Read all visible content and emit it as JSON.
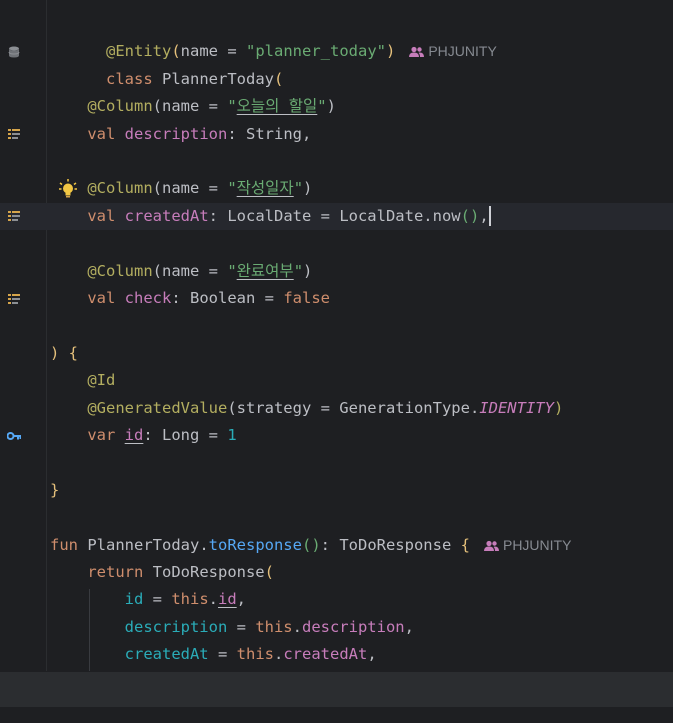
{
  "author_hint": "PHJUNITY",
  "lines": {
    "l1": {
      "ann": "@Entity",
      "p1": "(name = ",
      "str": "\"planner_today\"",
      "p2": ")"
    },
    "l2": {
      "kw": "class",
      "name": " PlannerToday",
      "paren": "("
    },
    "l4": {
      "ann": "@Column",
      "p1": "(name = ",
      "q1": "\"",
      "ko": "오늘의 할일",
      "q2": "\"",
      "p2": ")"
    },
    "l5": {
      "kw": "val",
      "prop": "description",
      "rest": ": String,"
    },
    "l7": {
      "ann": "@Column",
      "p1": "(name = ",
      "q1": "\"",
      "ko": "작성일자",
      "q2": "\"",
      "p2": ")"
    },
    "l8": {
      "kw": "val",
      "prop": "createdAt",
      "rest1": ": LocalDate = LocalDate.",
      "fn": "now",
      "call": "()",
      "comma": ","
    },
    "l10": {
      "ann": "@Column",
      "p1": "(name = ",
      "q1": "\"",
      "ko": "완료여부",
      "q2": "\"",
      "p2": ")"
    },
    "l11": {
      "kw": "val",
      "prop": "check",
      "rest": ": Boolean = ",
      "kw2": "false"
    },
    "l13": {
      "paren": ")",
      "brace": " {"
    },
    "l14": {
      "ann": "@Id"
    },
    "l15": {
      "ann": "@GeneratedValue",
      "p1": "(strategy = GenerationType.",
      "enum": "IDENTITY",
      "p2": ")"
    },
    "l16": {
      "kw": "var",
      "prop": "id",
      "rest": ": Long = ",
      "num": "1"
    },
    "l18": {
      "brace": "}"
    },
    "l20": {
      "kw": "fun",
      "recv": " PlannerToday.",
      "fn": "toResponse",
      "call": "()",
      "rest": ": ToDoResponse ",
      "brace": "{"
    },
    "l21": {
      "kw": "return",
      "rest": " ToDoResponse",
      "paren": "("
    },
    "l22": {
      "named": "id",
      "eq": " = ",
      "kw": "this",
      "dot": ".",
      "prop": "id",
      "comma": ","
    },
    "l23": {
      "named": "description",
      "eq": " = ",
      "kw": "this",
      "dot": ".",
      "prop": "description",
      "comma": ","
    },
    "l24": {
      "named": "createdAt",
      "eq": " = ",
      "kw": "this",
      "dot": ".",
      "prop": "createdAt",
      "comma": ","
    }
  },
  "icons": {
    "entity": "database-icon",
    "column": "column-mapping-icon",
    "id": "key-icon",
    "intention": "lightbulb-icon",
    "author": "people-icon"
  }
}
